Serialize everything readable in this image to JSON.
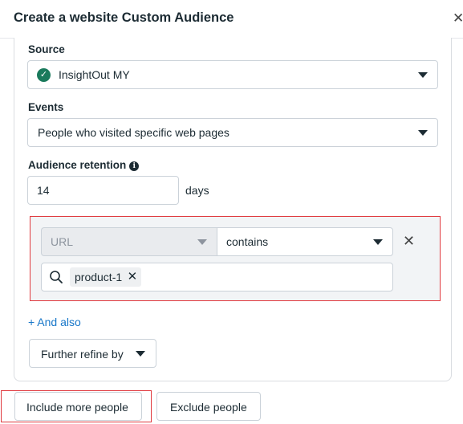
{
  "dialog": {
    "title": "Create a website Custom Audience",
    "close_icon": "close-icon"
  },
  "source": {
    "label": "Source",
    "value": "InsightOut MY",
    "status_icon": "check-circle-icon"
  },
  "events": {
    "label": "Events",
    "value": "People who visited specific web pages"
  },
  "retention": {
    "label": "Audience retention",
    "info_icon": "info-icon",
    "value": "14",
    "unit": "days"
  },
  "rule": {
    "field": "URL",
    "operator": "contains",
    "tags": [
      "product-1"
    ]
  },
  "actions": {
    "and_also": "+ And also",
    "further_refine": "Further refine by",
    "include_more": "Include more people",
    "exclude": "Exclude people"
  },
  "colors": {
    "highlight": "#e0393e",
    "link": "#1877c9",
    "success": "#1a7a5c"
  }
}
